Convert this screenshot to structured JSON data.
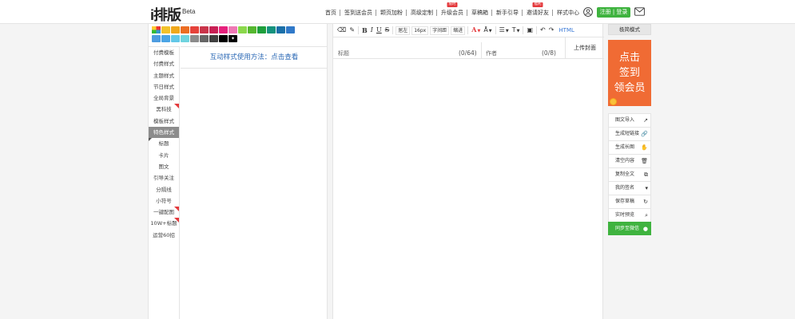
{
  "header": {
    "logo": "i排版",
    "logo_beta": "Beta",
    "nav": [
      {
        "label": "首页",
        "badge": ""
      },
      {
        "label": "签到送会员",
        "badge": ""
      },
      {
        "label": "颗页加粉",
        "badge": ""
      },
      {
        "label": "高级定制",
        "badge": ""
      },
      {
        "label": "升级会员",
        "badge": "限时"
      },
      {
        "label": "草稿箱",
        "badge": ""
      },
      {
        "label": "新手引导",
        "badge": ""
      },
      {
        "label": "邀请好友",
        "badge": "福利"
      },
      {
        "label": "样式中心",
        "badge": ""
      }
    ],
    "login_label": "注册 | 登录",
    "icons": {
      "user": "user-icon",
      "mail": "mail-icon"
    }
  },
  "palette": {
    "row1": [
      "#f2c22a",
      "#f0a81b",
      "#ec6d22",
      "#e5413a",
      "#c9344a",
      "#c81f54",
      "#e6207c",
      "#ef78b4",
      "#8bd84b",
      "#55b72f",
      "#1e9f3c",
      "#15927d",
      "#1a6fa8",
      "#3079c9"
    ],
    "row2": [
      "#4d9ce0",
      "#4aa5e5",
      "#62c8e8",
      "#6fd4df",
      "#8c8c8c",
      "#666666",
      "#3f3f3f",
      "#000000"
    ]
  },
  "categories": [
    {
      "label": "付费模板",
      "flag": false,
      "active": false
    },
    {
      "label": "付费样式",
      "flag": false,
      "active": false
    },
    {
      "label": "主题样式",
      "flag": false,
      "active": false
    },
    {
      "label": "节日样式",
      "flag": false,
      "active": false
    },
    {
      "label": "全局背景",
      "flag": false,
      "active": false
    },
    {
      "label": "黑科技",
      "flag": true,
      "active": false
    },
    {
      "label": "模板样式",
      "flag": false,
      "active": false
    },
    {
      "label": "特色样式",
      "flag": false,
      "active": true
    },
    {
      "label": "标题",
      "flag": false,
      "active": false
    },
    {
      "label": "卡片",
      "flag": false,
      "active": false
    },
    {
      "label": "图文",
      "flag": false,
      "active": false
    },
    {
      "label": "引导关注",
      "flag": false,
      "active": false
    },
    {
      "label": "分隔线",
      "flag": false,
      "active": false
    },
    {
      "label": "小符号",
      "flag": false,
      "active": false
    },
    {
      "label": "一键配图",
      "flag": true,
      "active": false
    },
    {
      "label": "10W+标题",
      "flag": true,
      "active": false
    },
    {
      "label": "运营60招",
      "flag": false,
      "active": false
    }
  ],
  "style_area": {
    "help_text": "互动样式使用方法：点击查看"
  },
  "toolbar": {
    "align_label": "居左",
    "font_size": "16px",
    "letter_spacing": "字间距",
    "indent": "缩进",
    "html_label": "HTML"
  },
  "editor": {
    "title_placeholder": "标题",
    "title_count": "(0/64)",
    "author_placeholder": "作者",
    "author_count": "(0/8)",
    "cover_label": "上传封面"
  },
  "right_panel": {
    "mode_label": "极简模式",
    "promo_text": "点击\n签到\n领会员",
    "actions": [
      {
        "label": "图文导入",
        "icon": "↗"
      },
      {
        "label": "生成短链接",
        "icon": "🔗"
      },
      {
        "label": "生成长图",
        "icon": "✋"
      },
      {
        "label": "清空内容",
        "icon": "🗑"
      },
      {
        "label": "复制全文",
        "icon": "⧉"
      },
      {
        "label": "我的签名",
        "icon": "▾"
      },
      {
        "label": "保存草稿",
        "icon": "↻"
      },
      {
        "label": "实时预览",
        "icon": "⌕"
      },
      {
        "label": "同步至微信",
        "icon": "●"
      }
    ]
  }
}
